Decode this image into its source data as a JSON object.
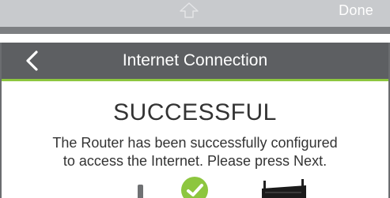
{
  "keyboard": {
    "done_label": "Done",
    "shift_icon": "shift-arrow-icon"
  },
  "header": {
    "title": "Internet Connection",
    "back_icon": "chevron-left-icon"
  },
  "content": {
    "status": "SUCCESSFUL",
    "message_line1": "The Router has been successfully configured",
    "message_line2": "to access the Internet. Please press Next."
  },
  "colors": {
    "header_bg": "#5d5f62",
    "accent_green": "#8dc63f",
    "keyboard_bg": "#c8cacd",
    "text": "#333333"
  }
}
